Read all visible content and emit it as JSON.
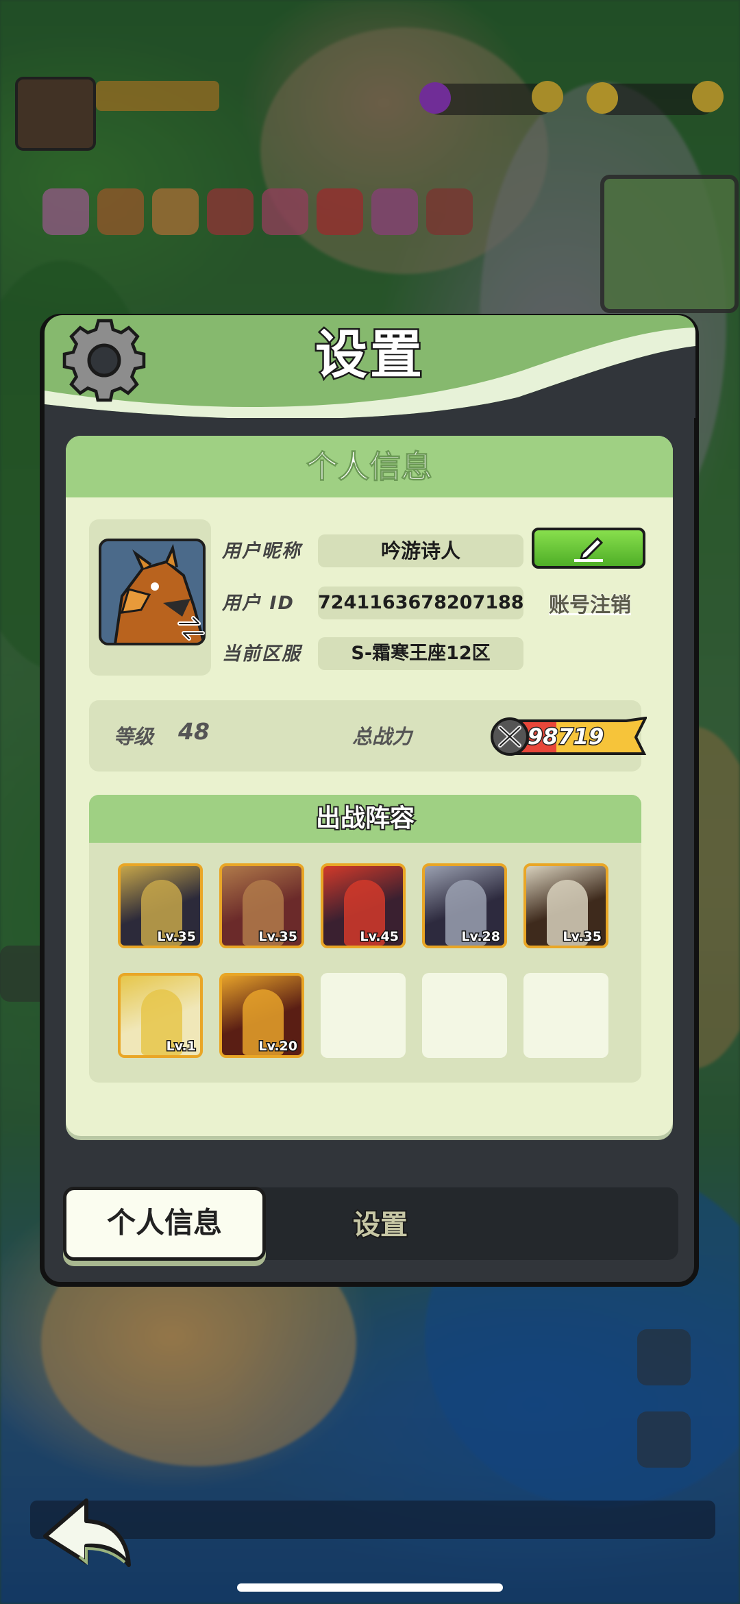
{
  "panel": {
    "title": "设置"
  },
  "personal_card": {
    "header": "个人信息",
    "nickname_label": "用户昵称",
    "nickname_value": "吟游诗人",
    "id_label": "用户 ID",
    "id_value": "7241163678207188",
    "logout_label": "账号注销",
    "server_label": "当前区服",
    "server_value": "S-霜寒王座12区"
  },
  "stats": {
    "level_label": "等级",
    "level_value": "48",
    "power_label": "总战力",
    "power_value": "98719"
  },
  "lineup": {
    "header": "出战阵容",
    "heroes": [
      {
        "level": "Lv.35",
        "color": "#2c2a3a",
        "accent": "#c6a64a"
      },
      {
        "level": "Lv.35",
        "color": "#6b2a2a",
        "accent": "#b07a4a"
      },
      {
        "level": "Lv.45",
        "color": "#3a2030",
        "accent": "#d23a2a"
      },
      {
        "level": "Lv.28",
        "color": "#2d2a3e",
        "accent": "#9aa0b0"
      },
      {
        "level": "Lv.35",
        "color": "#3e2a1c",
        "accent": "#d7d0bc"
      },
      {
        "level": "Lv.1",
        "color": "#f0e7b8",
        "accent": "#e6c64a"
      },
      {
        "level": "Lv.20",
        "color": "#5a1e14",
        "accent": "#e6a22a"
      }
    ],
    "empty_slots": 3
  },
  "tabs": {
    "active": "个人信息",
    "inactive": "设置"
  },
  "icons": {
    "gear": "gear-icon",
    "swap": "swap-icon",
    "edit": "edit-pencil-icon",
    "power": "crossed-swords-icon",
    "back": "back-arrow-icon"
  },
  "colors": {
    "header_green": "#86b96e",
    "card_bg": "#eaf2cf",
    "edit_button": "#5fbe2f",
    "hero_border": "#e9a626"
  }
}
